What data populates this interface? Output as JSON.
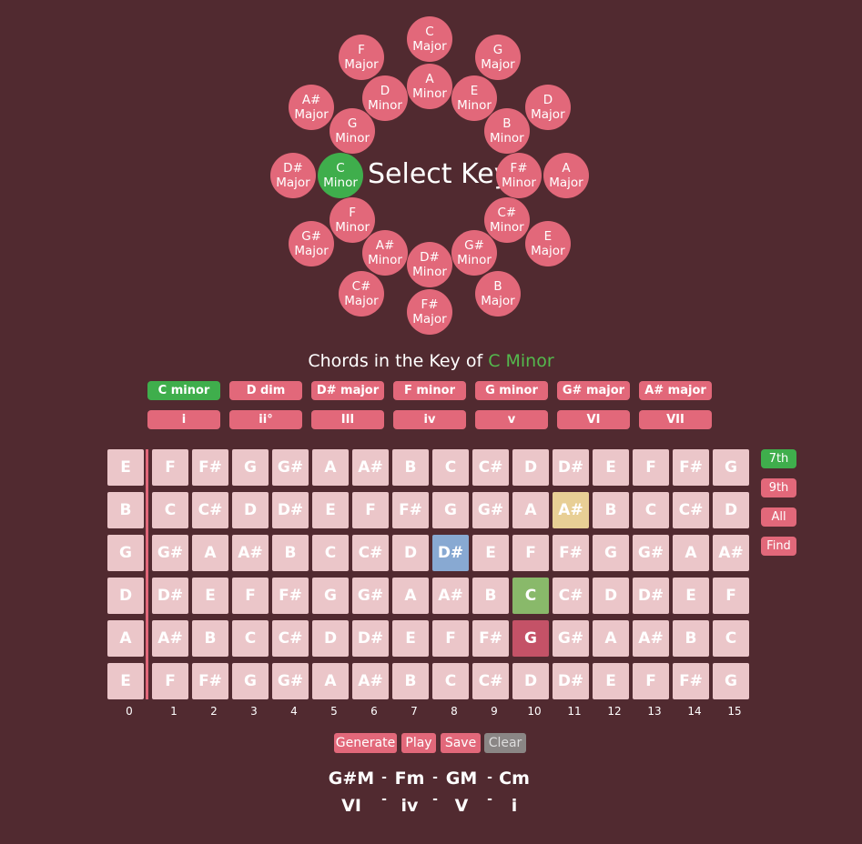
{
  "key_wheel": {
    "select_label": "Select Key",
    "selected_key": "C Minor",
    "keys": [
      {
        "root": "C",
        "quality": "Major"
      },
      {
        "root": "G",
        "quality": "Major"
      },
      {
        "root": "D",
        "quality": "Major"
      },
      {
        "root": "A",
        "quality": "Major"
      },
      {
        "root": "E",
        "quality": "Major"
      },
      {
        "root": "B",
        "quality": "Major"
      },
      {
        "root": "F#",
        "quality": "Major"
      },
      {
        "root": "C#",
        "quality": "Major"
      },
      {
        "root": "G#",
        "quality": "Major"
      },
      {
        "root": "D#",
        "quality": "Major"
      },
      {
        "root": "A#",
        "quality": "Major"
      },
      {
        "root": "F",
        "quality": "Major"
      },
      {
        "root": "A",
        "quality": "Minor"
      },
      {
        "root": "E",
        "quality": "Minor"
      },
      {
        "root": "B",
        "quality": "Minor"
      },
      {
        "root": "F#",
        "quality": "Minor"
      },
      {
        "root": "C#",
        "quality": "Minor"
      },
      {
        "root": "G#",
        "quality": "Minor"
      },
      {
        "root": "D#",
        "quality": "Minor"
      },
      {
        "root": "A#",
        "quality": "Minor"
      },
      {
        "root": "F",
        "quality": "Minor"
      },
      {
        "root": "C",
        "quality": "Minor"
      },
      {
        "root": "G",
        "quality": "Minor"
      },
      {
        "root": "D",
        "quality": "Minor"
      }
    ]
  },
  "chords_section": {
    "title_prefix": "Chords in the Key of",
    "title_key": "C Minor",
    "chords": [
      "C minor",
      "D dim",
      "D# major",
      "F minor",
      "G minor",
      "G# major",
      "A# major"
    ],
    "numerals": [
      "i",
      "ii°",
      "III",
      "iv",
      "v",
      "VI",
      "VII"
    ],
    "selected_chord": "C minor"
  },
  "fretboard": {
    "strings": [
      [
        "E",
        "F",
        "F#",
        "G",
        "G#",
        "A",
        "A#",
        "B",
        "C",
        "C#",
        "D",
        "D#",
        "E",
        "F",
        "F#",
        "G"
      ],
      [
        "B",
        "C",
        "C#",
        "D",
        "D#",
        "E",
        "F",
        "F#",
        "G",
        "G#",
        "A",
        "A#",
        "B",
        "C",
        "C#",
        "D"
      ],
      [
        "G",
        "G#",
        "A",
        "A#",
        "B",
        "C",
        "C#",
        "D",
        "D#",
        "E",
        "F",
        "F#",
        "G",
        "G#",
        "A",
        "A#"
      ],
      [
        "D",
        "D#",
        "E",
        "F",
        "F#",
        "G",
        "G#",
        "A",
        "A#",
        "B",
        "C",
        "C#",
        "D",
        "D#",
        "E",
        "F"
      ],
      [
        "A",
        "A#",
        "B",
        "C",
        "C#",
        "D",
        "D#",
        "E",
        "F",
        "F#",
        "G",
        "G#",
        "A",
        "A#",
        "B",
        "C"
      ],
      [
        "E",
        "F",
        "F#",
        "G",
        "G#",
        "A",
        "A#",
        "B",
        "C",
        "C#",
        "D",
        "D#",
        "E",
        "F",
        "F#",
        "G"
      ]
    ],
    "fret_numbers": [
      "0",
      "1",
      "2",
      "3",
      "4",
      "5",
      "6",
      "7",
      "8",
      "9",
      "10",
      "11",
      "12",
      "13",
      "14",
      "15"
    ],
    "highlights": [
      {
        "string": 1,
        "fret": 11,
        "color": "#e8cf95"
      },
      {
        "string": 2,
        "fret": 8,
        "color": "#88a9d2"
      },
      {
        "string": 3,
        "fret": 10,
        "color": "#89b96a"
      },
      {
        "string": 4,
        "fret": 10,
        "color": "#c45267"
      }
    ],
    "cell_color": "#ebc6c9"
  },
  "side_buttons": [
    {
      "label": "7th",
      "active": true
    },
    {
      "label": "9th",
      "active": false
    },
    {
      "label": "All",
      "active": false
    },
    {
      "label": "Find",
      "active": false
    }
  ],
  "controls": [
    {
      "label": "Generate",
      "enabled": true
    },
    {
      "label": "Play",
      "enabled": true
    },
    {
      "label": "Save",
      "enabled": true
    },
    {
      "label": "Clear",
      "enabled": false
    }
  ],
  "progression": {
    "chords": [
      "G#M",
      "Fm",
      "GM",
      "Cm"
    ],
    "numerals": [
      "VI",
      "iv",
      "V",
      "i"
    ],
    "separator": "-"
  },
  "colors": {
    "background": "#512a30",
    "accent": "#e2687a",
    "selected": "#3fae4c",
    "disabled": "#8a8685"
  }
}
